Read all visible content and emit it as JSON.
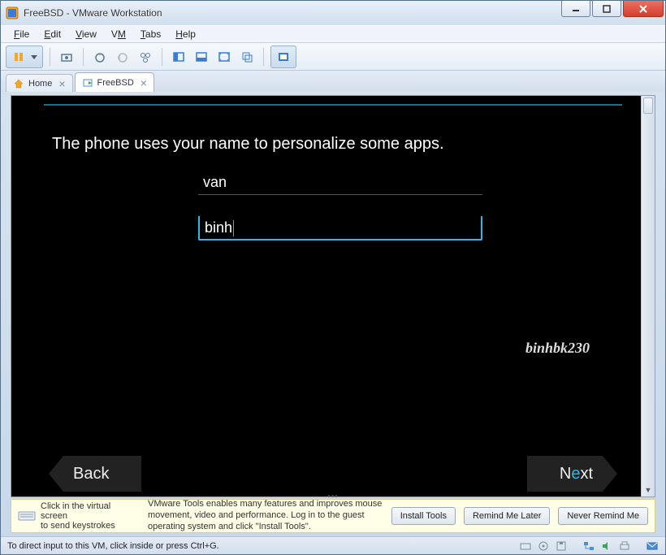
{
  "window": {
    "title": "FreeBSD - VMware Workstation"
  },
  "menu": {
    "file": "File",
    "edit": "Edit",
    "view": "View",
    "vm": "VM",
    "tabs": "Tabs",
    "help": "Help"
  },
  "tabs": [
    {
      "label": "Home"
    },
    {
      "label": "FreeBSD"
    }
  ],
  "vm": {
    "prompt": "The phone uses your name to personalize some apps.",
    "first_name": "van",
    "last_name": "binh",
    "watermark": "binhbk230",
    "back": "Back",
    "next": "Next"
  },
  "infobar": {
    "hint_line1": "Click in the virtual screen",
    "hint_line2": "to send keystrokes",
    "tools_msg": "VMware Tools enables many features and improves mouse movement, video and performance. Log in to the guest operating system and click \"Install Tools\".",
    "install": "Install Tools",
    "remind": "Remind Me Later",
    "never": "Never Remind Me"
  },
  "status": {
    "text": "To direct input to this VM, click inside or press Ctrl+G."
  }
}
